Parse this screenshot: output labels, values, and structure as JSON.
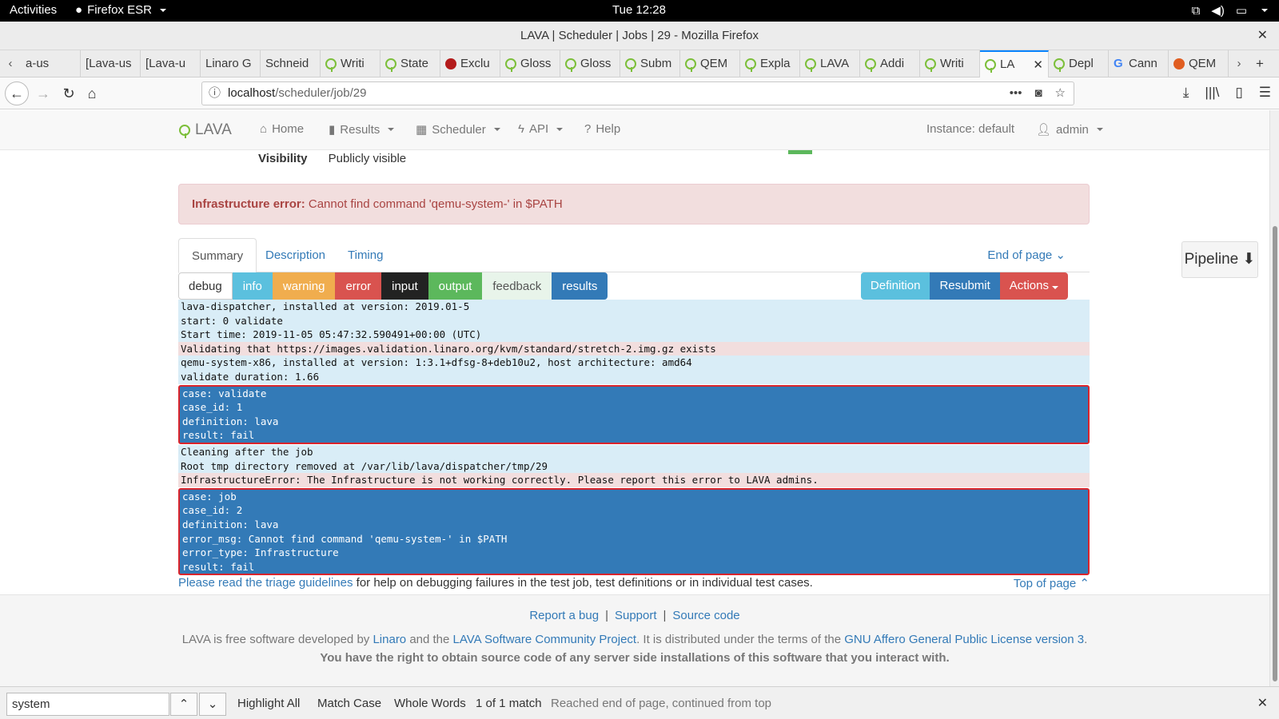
{
  "system_bar": {
    "activities": "Activities",
    "app_name": "Firefox ESR",
    "clock": "Tue 12:28"
  },
  "window": {
    "title": "LAVA | Scheduler | Jobs | 29 - Mozilla Firefox"
  },
  "tabs": [
    {
      "label": "a-us",
      "icon": "none"
    },
    {
      "label": "[Lava-us",
      "icon": "none"
    },
    {
      "label": "[Lava-u",
      "icon": "none"
    },
    {
      "label": "Linaro G",
      "icon": "none"
    },
    {
      "label": "Schneid",
      "icon": "none"
    },
    {
      "label": "Writi",
      "icon": "lava"
    },
    {
      "label": "State",
      "icon": "lava"
    },
    {
      "label": "Exclu",
      "icon": "red"
    },
    {
      "label": "Gloss",
      "icon": "lava"
    },
    {
      "label": "Gloss",
      "icon": "lava"
    },
    {
      "label": "Subm",
      "icon": "lava"
    },
    {
      "label": "QEM",
      "icon": "lava"
    },
    {
      "label": "Expla",
      "icon": "lava"
    },
    {
      "label": "LAVA",
      "icon": "lava"
    },
    {
      "label": "Addi",
      "icon": "lava"
    },
    {
      "label": "Writi",
      "icon": "lava"
    },
    {
      "label": "LA",
      "icon": "lava",
      "active": true
    },
    {
      "label": "Depl",
      "icon": "lava"
    },
    {
      "label": "Cann",
      "icon": "google"
    },
    {
      "label": "QEM",
      "icon": "orange"
    }
  ],
  "urlbar": {
    "host": "localhost",
    "path": "/scheduler/job/29"
  },
  "lava_nav": {
    "brand": "LAVA",
    "home": "Home",
    "results": "Results",
    "scheduler": "Scheduler",
    "api": "API",
    "help": "Help",
    "instance": "Instance: default",
    "user": "admin"
  },
  "job": {
    "visibility_label": "Visibility",
    "visibility_value": "Publicly visible",
    "alert_title": "Infrastructure error:",
    "alert_message": "Cannot find command 'qemu-system-' in $PATH"
  },
  "page_tabs": {
    "summary": "Summary",
    "description": "Description",
    "timing": "Timing",
    "end_of_page": "End of page"
  },
  "filters": [
    "debug",
    "info",
    "warning",
    "error",
    "input",
    "output",
    "feedback",
    "results"
  ],
  "actions": {
    "definition": "Definition",
    "resubmit": "Resubmit",
    "actions": "Actions"
  },
  "pipeline_label": "Pipeline",
  "log": [
    {
      "kind": "dbg",
      "text": "lava-dispatcher, installed at version: 2019.01-5"
    },
    {
      "kind": "dbg",
      "text": "start: 0 validate"
    },
    {
      "kind": "dbg",
      "text": "Start time: 2019-11-05 05:47:32.590491+00:00 (UTC)"
    },
    {
      "kind": "err",
      "text": "Validating that https://images.validation.linaro.org/kvm/standard/stretch-2.img.gz exists"
    },
    {
      "kind": "dbg",
      "text": "qemu-system-x86, installed at version: 1:3.1+dfsg-8+deb10u2, host architecture: amd64"
    },
    {
      "kind": "dbg",
      "text": "validate duration: 1.66"
    },
    {
      "kind": "block",
      "lines": [
        "case: validate",
        "case_id: 1",
        "definition: lava",
        "result: fail"
      ]
    },
    {
      "kind": "dbg",
      "text": "Cleaning after the job"
    },
    {
      "kind": "dbg",
      "text": "Root tmp directory removed at /var/lib/lava/dispatcher/tmp/29"
    },
    {
      "kind": "err",
      "text": "InfrastructureError: The Infrastructure is not working correctly. Please report this error to LAVA admins."
    },
    {
      "kind": "block",
      "lines": [
        "case: job",
        "case_id: 2",
        "definition: lava",
        "error_msg: Cannot find command 'qemu-system-' in $PATH",
        "error_type: Infrastructure",
        "result: fail"
      ]
    }
  ],
  "triage": {
    "link": "Please read the triage guidelines",
    "rest": " for help on debugging failures in the test job, test definitions or in individual test cases.",
    "top_of_page": "Top of page"
  },
  "footer": {
    "report_bug": "Report a bug",
    "support": "Support",
    "source_code": "Source code",
    "desc_1": "LAVA is free software developed by ",
    "linaro": "Linaro",
    "desc_2": " and the ",
    "community": "LAVA Software Community Project",
    "desc_3": ". It is distributed under the terms of the ",
    "license": "GNU Affero General Public License version 3",
    "desc_4": ".",
    "rights": "You have the right to obtain source code of any server side installations of this software that you interact with."
  },
  "findbar": {
    "query": "system",
    "highlight_all": "Highlight All",
    "match_case": "Match Case",
    "whole_words": "Whole Words",
    "count": "1 of 1 match",
    "status": "Reached end of page, continued from top"
  }
}
